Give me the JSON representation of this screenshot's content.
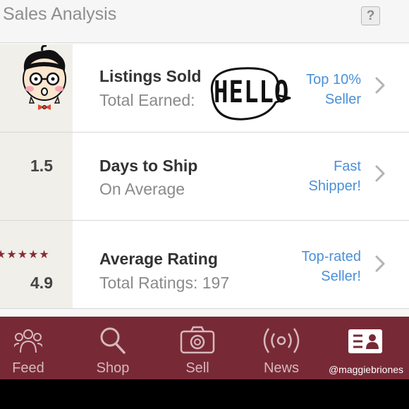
{
  "header": {
    "title": "Sales Analysis",
    "help_label": "?"
  },
  "rows": [
    {
      "value": "",
      "title": "Listings Sold",
      "subtitle": "Total Earned:",
      "badge_line1": "Top 10%",
      "badge_line2": "Seller"
    },
    {
      "value": "1.5",
      "title": "Days to Ship",
      "subtitle": "On Average",
      "badge_line1": "Fast",
      "badge_line2": "Shipper!"
    },
    {
      "value": "4.9",
      "stars": "★★★★★",
      "title": "Average Rating",
      "subtitle": "Total Ratings: 197",
      "badge_line1": "Top-rated",
      "badge_line2": "Seller!"
    }
  ],
  "stickers": {
    "bubble_text": "HELLO"
  },
  "tabbar": {
    "tabs": [
      {
        "label": "Feed",
        "icon": "people-icon"
      },
      {
        "label": "Shop",
        "icon": "search-icon"
      },
      {
        "label": "Sell",
        "icon": "camera-icon"
      },
      {
        "label": "News",
        "icon": "broadcast-icon"
      },
      {
        "label": "@maggiebriones",
        "icon": "profile-card-icon"
      }
    ],
    "active_index": 4
  },
  "colors": {
    "tabbar": "#772a36",
    "accent_link": "#4a90d9",
    "star": "#8a2a35"
  }
}
